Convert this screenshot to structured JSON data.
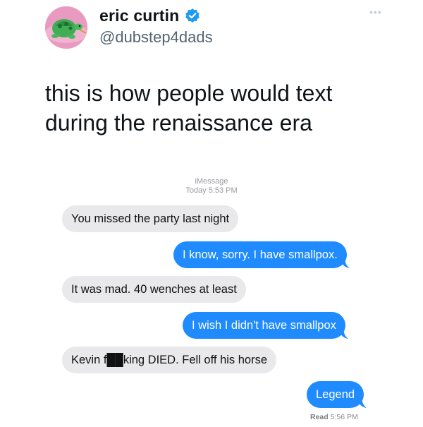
{
  "tweet": {
    "author": {
      "display_name": "eric curtin",
      "handle": "@dubstep4dads",
      "verified": true,
      "avatar_icon": "green-turtle-avatar-icon"
    },
    "more_menu_icon": "more-dots-icon",
    "text": "this is how people would text\nduring the renaissance era"
  },
  "imessage": {
    "service_label": "iMessage",
    "timestamp": "Today 5:53 PM",
    "messages": [
      {
        "direction": "received",
        "text": "You missed the party last night"
      },
      {
        "direction": "sent",
        "text": "I know, sorry. I have smallpox."
      },
      {
        "direction": "received",
        "text": "It was mad. 40 wenches at least"
      },
      {
        "direction": "sent",
        "text": "I wish I didn't have smallpox"
      },
      {
        "direction": "received",
        "text": "Kevin f██king DIED. Fell off his horse"
      },
      {
        "direction": "sent",
        "text": "Legend"
      }
    ],
    "read_label": "Read",
    "read_time": "5:56 PM"
  },
  "colors": {
    "sent_bubble": "#1f8bff",
    "received_bubble": "#e9e9eb",
    "verified_badge": "#1d9bf0"
  }
}
